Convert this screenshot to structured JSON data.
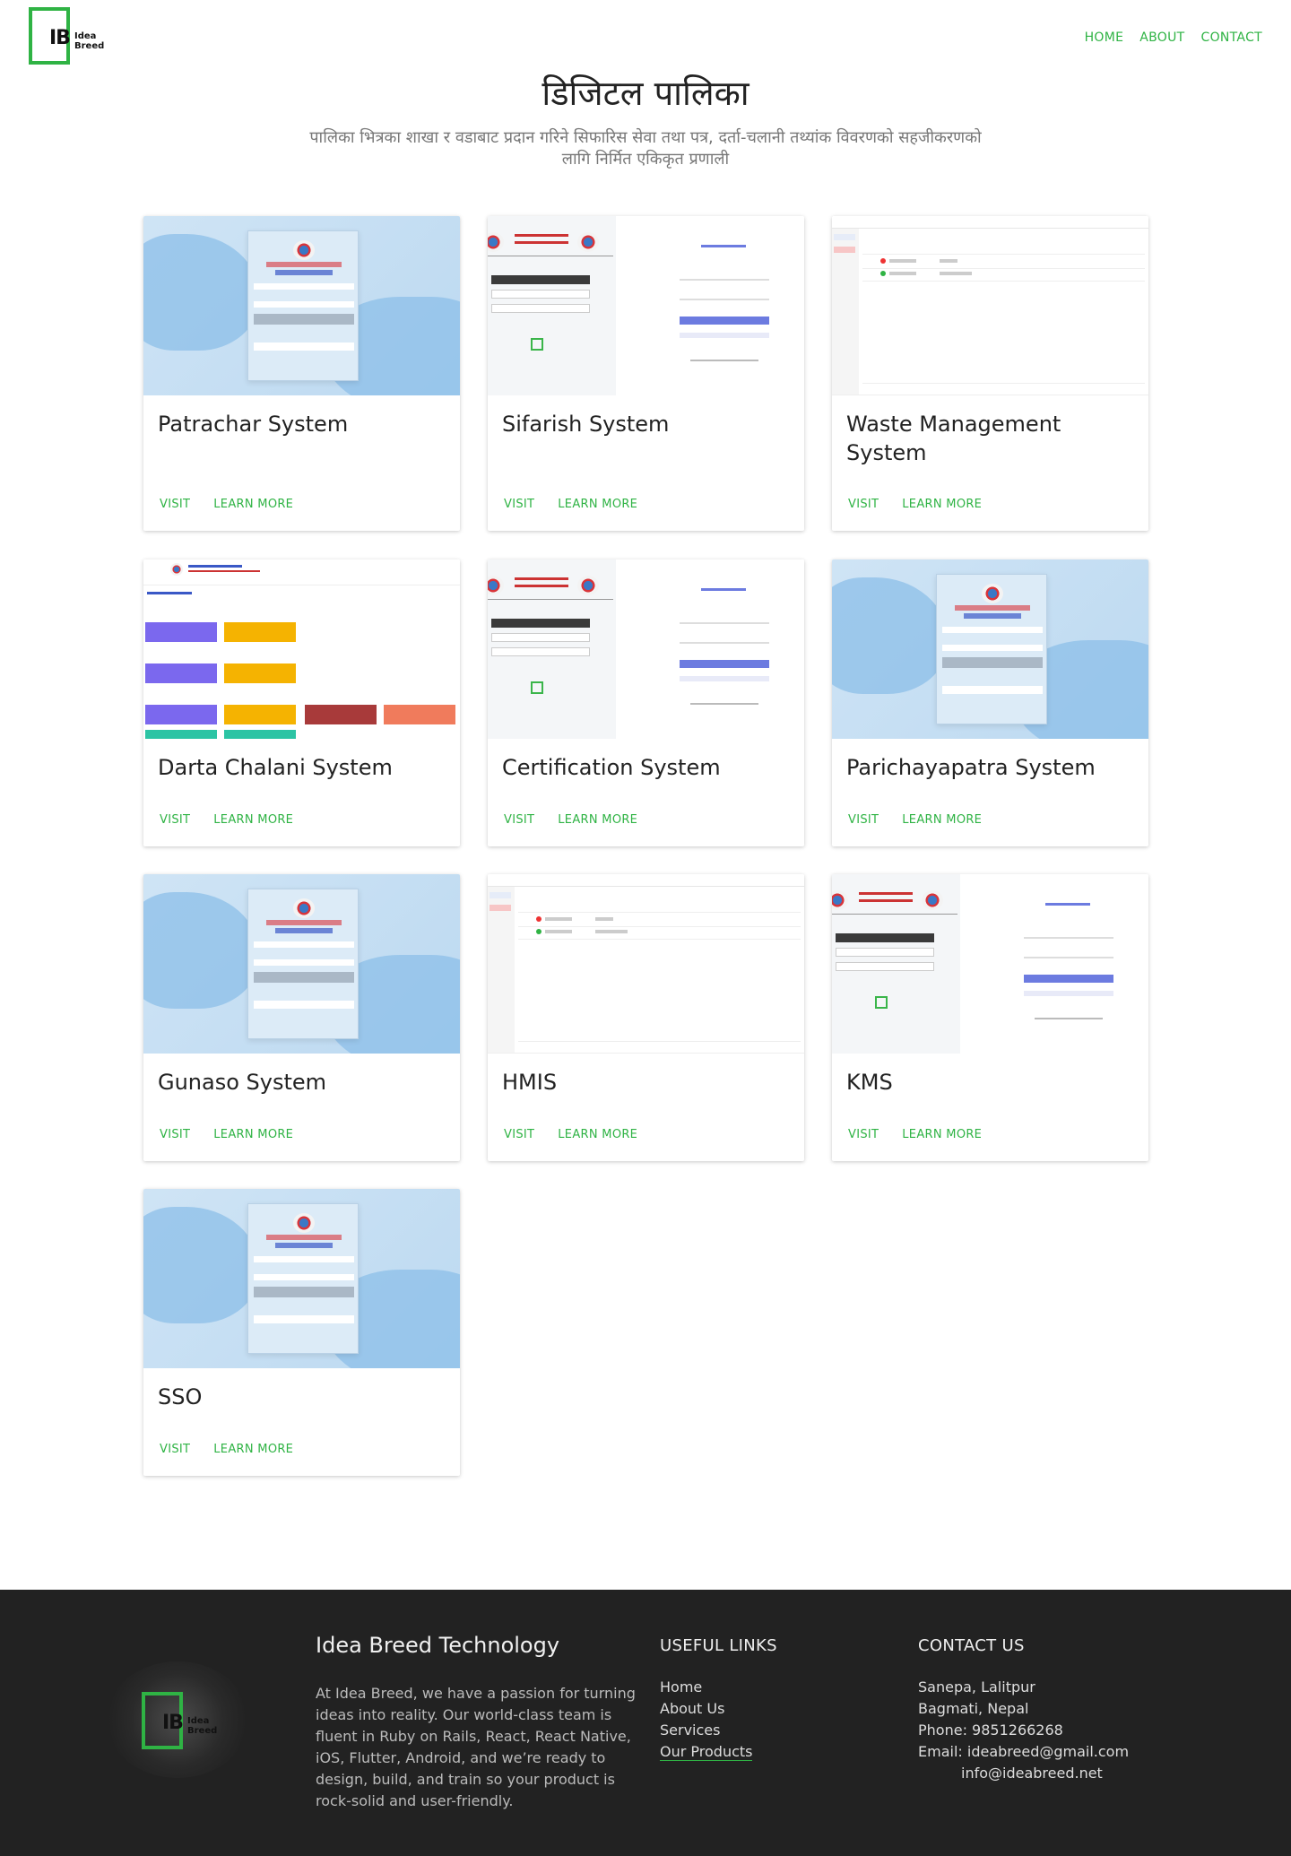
{
  "brand": {
    "logo_letters": "IB",
    "logo_line1": "Idea",
    "logo_line2": "Breed"
  },
  "nav": {
    "home": "HOME",
    "about": "ABOUT",
    "contact": "CONTACT"
  },
  "hero": {
    "title": "डिजिटल पालिका",
    "subtitle": "पालिका भित्रका शाखा र वडाबाट प्रदान गरिने सिफारिस सेवा तथा पत्र, दर्ता-चलानी तथ्यांक विवरणको सहजीकरणको लागि निर्मित एकिकृत प्रणाली"
  },
  "cards": [
    {
      "title": "Patrachar System",
      "visit": "VISIT",
      "learn": "LEARN MORE",
      "thumb": "login"
    },
    {
      "title": "Sifarish System",
      "visit": "VISIT",
      "learn": "LEARN MORE",
      "thumb": "sifarish"
    },
    {
      "title": "Waste Management System",
      "visit": "VISIT",
      "learn": "LEARN MORE",
      "thumb": "waste"
    },
    {
      "title": "Darta Chalani System",
      "visit": "VISIT",
      "learn": "LEARN MORE",
      "thumb": "darta"
    },
    {
      "title": "Certification System",
      "visit": "VISIT",
      "learn": "LEARN MORE",
      "thumb": "sifarish"
    },
    {
      "title": "Parichayapatra System",
      "visit": "VISIT",
      "learn": "LEARN MORE",
      "thumb": "login"
    },
    {
      "title": "Gunaso System",
      "visit": "VISIT",
      "learn": "LEARN MORE",
      "thumb": "login"
    },
    {
      "title": "HMIS",
      "visit": "VISIT",
      "learn": "LEARN MORE",
      "thumb": "waste"
    },
    {
      "title": "KMS",
      "visit": "VISIT",
      "learn": "LEARN MORE",
      "thumb": "sifarish"
    },
    {
      "title": "SSO",
      "visit": "VISIT",
      "learn": "LEARN MORE",
      "thumb": "login"
    }
  ],
  "footer": {
    "company": "Idea Breed Technology",
    "about": "At Idea Breed, we have a passion for turning ideas into reality. Our world-class team is fluent in Ruby on Rails, React, React Native, iOS, Flutter, Android, and we’re ready to design, build, and train so your product is rock-solid and user-friendly.",
    "links_title": "USEFUL LINKS",
    "links": [
      "Home",
      "About Us",
      "Services",
      "Our Products"
    ],
    "contact_title": "CONTACT US",
    "contact_lines": [
      "Sanepa, Lalitpur",
      "Bagmati, Nepal",
      "Phone: 9851266268",
      "Email: ideabreed@gmail.com",
      "info@ideabreed.net"
    ]
  },
  "colors": {
    "accent": "#2fb344",
    "footer_bg": "#222222"
  }
}
